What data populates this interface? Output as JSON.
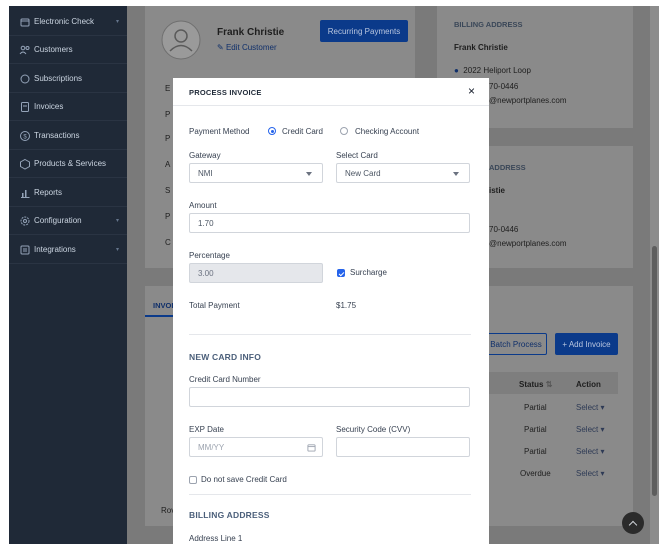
{
  "sidebar": {
    "items": [
      {
        "label": "Electronic Check",
        "icon": "bank-icon",
        "caret": true
      },
      {
        "label": "Customers",
        "icon": "users-icon",
        "caret": false
      },
      {
        "label": "Subscriptions",
        "icon": "refresh-icon",
        "caret": false
      },
      {
        "label": "Invoices",
        "icon": "invoice-icon",
        "caret": false
      },
      {
        "label": "Transactions",
        "icon": "dollar-icon",
        "caret": false
      },
      {
        "label": "Products & Services",
        "icon": "box-icon",
        "caret": false
      },
      {
        "label": "Reports",
        "icon": "chart-icon",
        "caret": false
      },
      {
        "label": "Configuration",
        "icon": "gear-icon",
        "caret": true
      },
      {
        "label": "Integrations",
        "icon": "plug-icon",
        "caret": true
      }
    ]
  },
  "customer": {
    "name": "Frank Christie",
    "edit_label": "Edit Customer",
    "recurring_button": "Recurring Payments"
  },
  "billing_card": {
    "heading": "BILLING ADDRESS",
    "name": "Frank Christie",
    "address": "2022 Heliport Loop",
    "phone_fragment": "70-0446",
    "email_fragment": "@newportplanes.com"
  },
  "shipping_card": {
    "heading_fragment": "ADDRESS",
    "name_fragment": "istie",
    "phone_fragment": "70-0446",
    "email_fragment": "@newportplanes.com"
  },
  "background_fragments": {
    "side_letters": [
      "E",
      "P",
      "P",
      "A",
      "S",
      "P",
      "C"
    ],
    "tab_fragment": "INVOI",
    "row_fragment": "Rov",
    "batch_button": "Batch Process",
    "add_invoice_button": "+ Add Invoice"
  },
  "table": {
    "headers": {
      "status": "Status",
      "action": "Action"
    },
    "rows": [
      {
        "status": "Partial",
        "action": "Select"
      },
      {
        "status": "Partial",
        "action": "Select"
      },
      {
        "status": "Partial",
        "action": "Select"
      },
      {
        "status": "Overdue",
        "action": "Select"
      }
    ]
  },
  "modal": {
    "title": "PROCESS INVOICE",
    "close": "×",
    "payment_method_label": "Payment Method",
    "option_credit": "Credit Card",
    "option_checking": "Checking Account",
    "gateway_label": "Gateway",
    "gateway_value": "NMI",
    "select_card_label": "Select Card",
    "select_card_value": "New Card",
    "amount_label": "Amount",
    "amount_value": "1.70",
    "percentage_label": "Percentage",
    "percentage_value": "3.00",
    "surcharge_label": "Surcharge",
    "total_label": "Total Payment",
    "total_value": "$1.75",
    "new_card_heading": "NEW CARD INFO",
    "card_number_label": "Credit Card Number",
    "card_number_value": "",
    "exp_label": "EXP Date",
    "exp_placeholder": "MM/YY",
    "cvv_label": "Security Code (CVV)",
    "cvv_value": "",
    "dont_save_label": "Do not save Credit Card",
    "billing_heading": "BILLING ADDRESS",
    "address_line1_label": "Address Line 1"
  }
}
